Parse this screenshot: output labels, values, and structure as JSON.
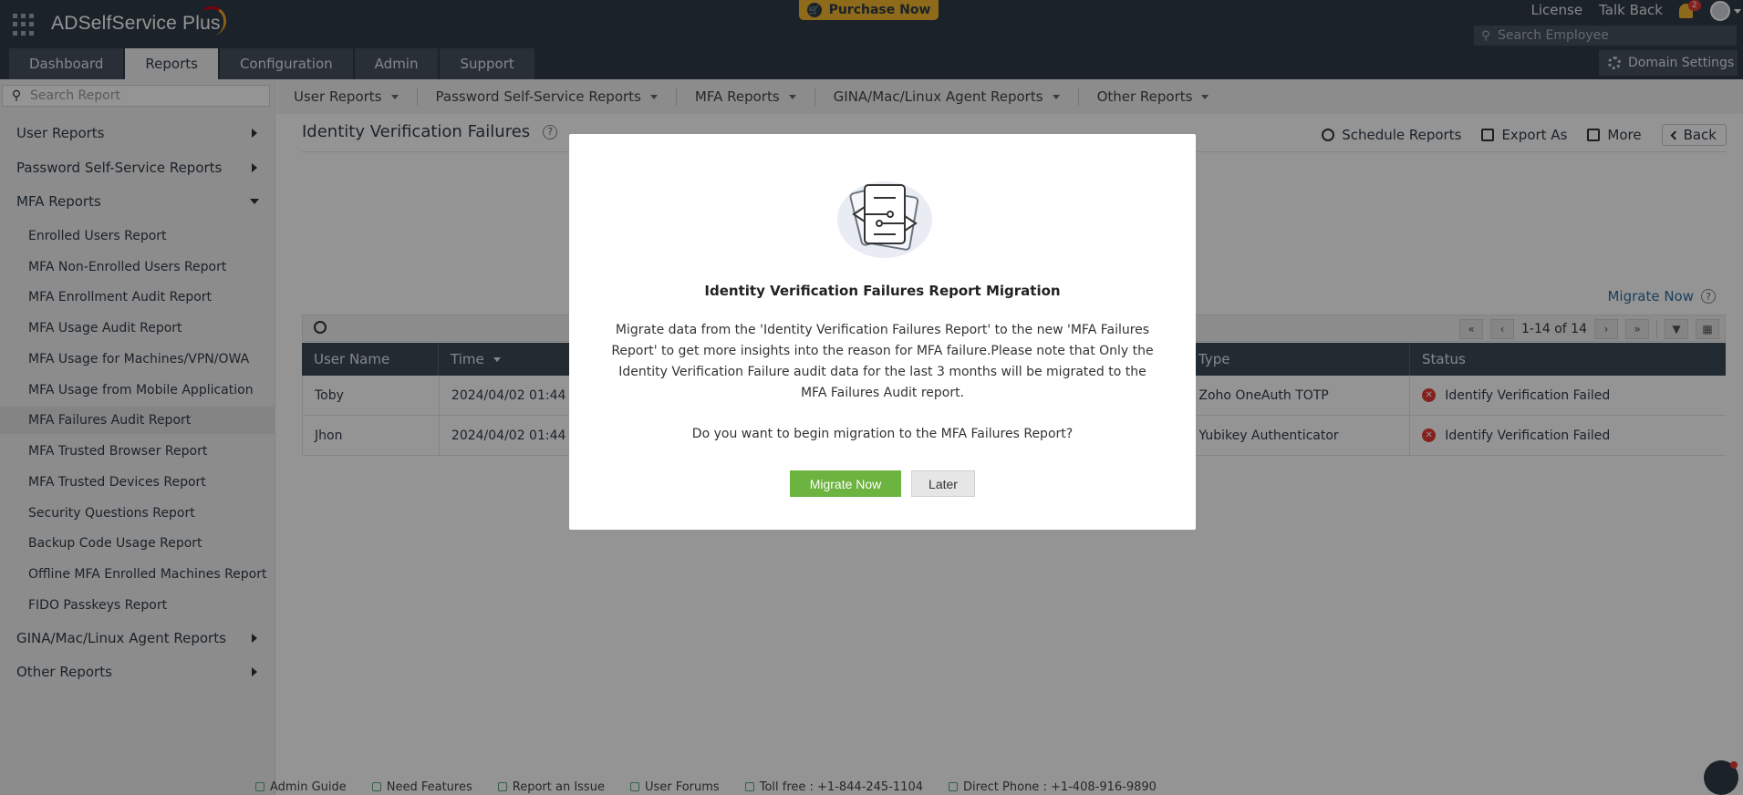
{
  "header": {
    "app_name": "ADSelfService Plus",
    "purchase_label": "Purchase Now",
    "links": [
      "License",
      "Talk Back"
    ],
    "notification_count": "2",
    "employee_search_placeholder": "Search Employee",
    "domain_settings_label": "Domain Settings",
    "tabs": [
      {
        "label": "Dashboard",
        "active": false
      },
      {
        "label": "Reports",
        "active": true
      },
      {
        "label": "Configuration",
        "active": false
      },
      {
        "label": "Admin",
        "active": false
      },
      {
        "label": "Support",
        "active": false
      }
    ]
  },
  "sidebar": {
    "search_placeholder": "Search Report",
    "groups": {
      "user_reports": "User Reports",
      "password_reports": "Password Self-Service Reports",
      "mfa_reports": "MFA Reports",
      "gina_reports": "GINA/Mac/Linux Agent Reports",
      "other_reports": "Other Reports"
    },
    "mfa_items": [
      "Enrolled Users Report",
      "MFA Non-Enrolled Users Report",
      "MFA Enrollment Audit Report",
      "MFA Usage Audit Report",
      "MFA Usage for Machines/VPN/OWA",
      "MFA Usage from Mobile Application",
      "MFA Failures Audit Report",
      "MFA Trusted Browser Report",
      "MFA Trusted Devices Report",
      "Security Questions Report",
      "Backup Code Usage Report",
      "Offline MFA Enrolled Machines Report",
      "FIDO Passkeys Report"
    ],
    "active_item": "MFA Failures Audit Report"
  },
  "subnav": [
    "User Reports",
    "Password Self-Service Reports",
    "MFA Reports",
    "GINA/Mac/Linux Agent Reports",
    "Other Reports"
  ],
  "main": {
    "title": "Identity Verification Failures",
    "help_glyph": "?",
    "actions": {
      "schedule": "Schedule Reports",
      "export": "Export As",
      "more": "More",
      "back": "Back"
    },
    "migrate_link": "Migrate Now",
    "pager": {
      "range": "1-14 of 14"
    },
    "columns": [
      "User Name",
      "Time",
      "Type",
      "Status"
    ],
    "rows": [
      {
        "user": "Toby",
        "time": "2024/04/02 01:44",
        "type": "Zoho OneAuth TOTP",
        "status": "Identify Verification Failed"
      },
      {
        "user": "Jhon",
        "time": "2024/04/02 01:44",
        "type": "Yubikey Authenticator",
        "status": "Identify Verification Failed"
      }
    ]
  },
  "footer": {
    "admin_guide": "Admin Guide",
    "need_features": "Need Features",
    "report_issue": "Report an Issue",
    "user_forums": "User Forums",
    "toll_free": "Toll free : +1-844-245-1104",
    "direct_phone": "Direct Phone : +1-408-916-9890"
  },
  "modal": {
    "title": "Identity Verification Failures Report Migration",
    "body": "Migrate data from the 'Identity Verification Failures Report' to the new 'MFA Failures Report' to get more insights into the reason for MFA failure.Please note that Only the Identity Verification Failure audit data for the last 3 months will be migrated to the MFA Failures Audit report.",
    "question": "Do you want to begin migration to the MFA Failures Report?",
    "primary_button": "Migrate Now",
    "secondary_button": "Later"
  },
  "colors": {
    "header_bg": "#2f3c48",
    "accent_green": "#6cb33f",
    "purchase_yellow": "#f5b82e",
    "error_red": "#e53935"
  }
}
